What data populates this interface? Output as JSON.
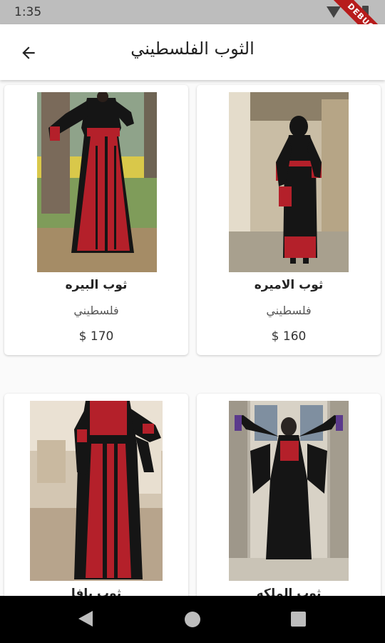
{
  "status_bar": {
    "time": "1:35",
    "debug_label": "DEBUG"
  },
  "app_bar": {
    "title": "الثوب الفلسطيني",
    "back_icon": "arrow-back-icon"
  },
  "products": [
    {
      "name": "ثوب البيره",
      "origin": "فلسطيني",
      "price": "$ 170"
    },
    {
      "name": "ثوب الاميره",
      "origin": "فلسطيني",
      "price": "$ 160"
    },
    {
      "name": "ثوب يافا",
      "origin": "",
      "price": ""
    },
    {
      "name": "ثوب الملكه",
      "origin": "",
      "price": ""
    }
  ],
  "colors": {
    "dress_black": "#151515",
    "embroidery_red": "#b4202a",
    "app_bar": "#ffffff"
  }
}
